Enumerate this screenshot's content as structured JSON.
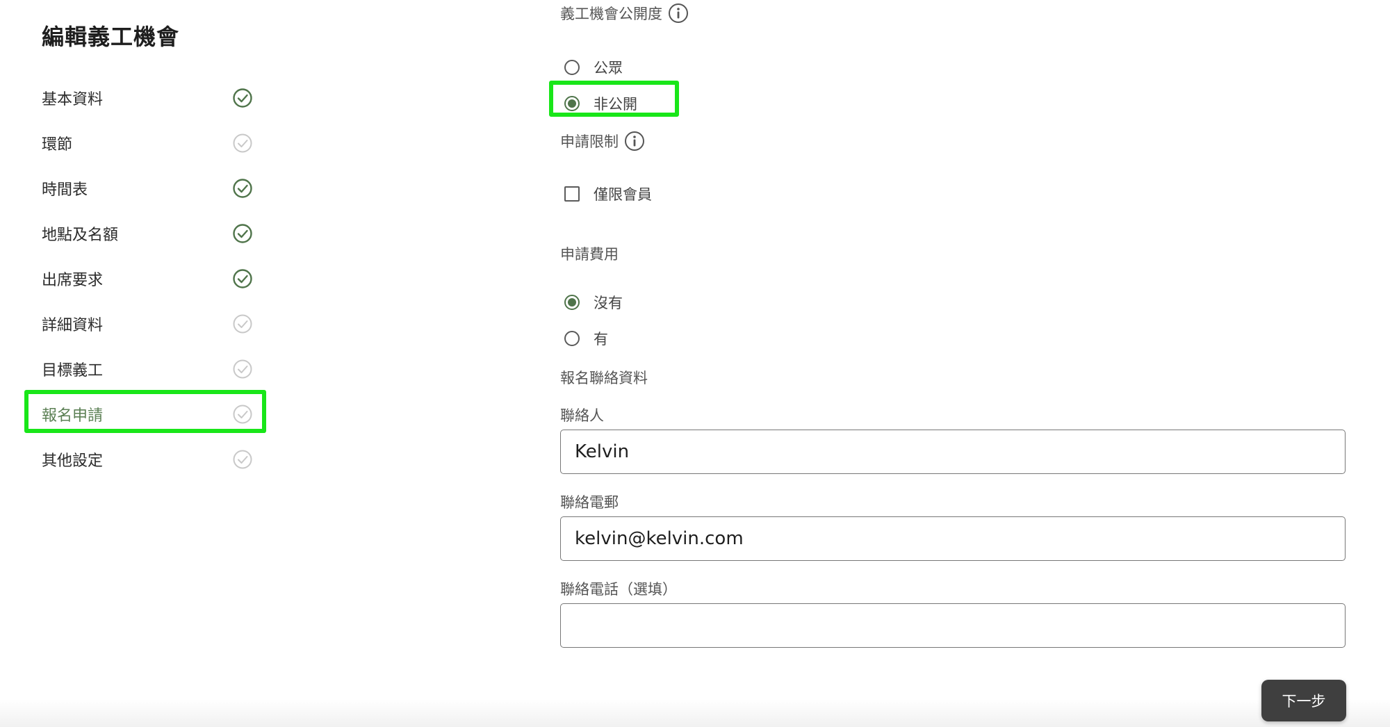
{
  "page": {
    "title": "編輯義工機會"
  },
  "sidebar": {
    "items": [
      {
        "label": "基本資料",
        "status": "complete"
      },
      {
        "label": "環節",
        "status": "incomplete"
      },
      {
        "label": "時間表",
        "status": "complete"
      },
      {
        "label": "地點及名額",
        "status": "complete"
      },
      {
        "label": "出席要求",
        "status": "complete"
      },
      {
        "label": "詳細資料",
        "status": "incomplete"
      },
      {
        "label": "目標義工",
        "status": "incomplete"
      },
      {
        "label": "報名申請",
        "status": "incomplete",
        "active": true
      },
      {
        "label": "其他設定",
        "status": "incomplete"
      }
    ]
  },
  "visibility": {
    "label": "義工機會公開度",
    "options": [
      {
        "label": "公眾",
        "checked": false
      },
      {
        "label": "非公開",
        "checked": true
      }
    ]
  },
  "restriction": {
    "label": "申請限制",
    "members_only": {
      "label": "僅限會員",
      "checked": false
    }
  },
  "fee": {
    "label": "申請費用",
    "options": [
      {
        "label": "沒有",
        "checked": true
      },
      {
        "label": "有",
        "checked": false
      }
    ]
  },
  "contact": {
    "section_label": "報名聯絡資料",
    "person": {
      "label": "聯絡人",
      "value": "Kelvin"
    },
    "email": {
      "label": "聯絡電郵",
      "value": "kelvin@kelvin.com"
    },
    "phone": {
      "label": "聯絡電話（選填）",
      "value": ""
    }
  },
  "actions": {
    "next_label": "下一步"
  },
  "colors": {
    "accent_green": "#4f744a",
    "active_label": "#5c8055",
    "highlight": "#19e619",
    "check_inactive": "#c8c8c8",
    "button_bg": "#3f3f3f"
  },
  "icons": {
    "complete": "check-circle-icon",
    "incomplete": "check-circle-outline-icon",
    "info": "info-icon"
  }
}
